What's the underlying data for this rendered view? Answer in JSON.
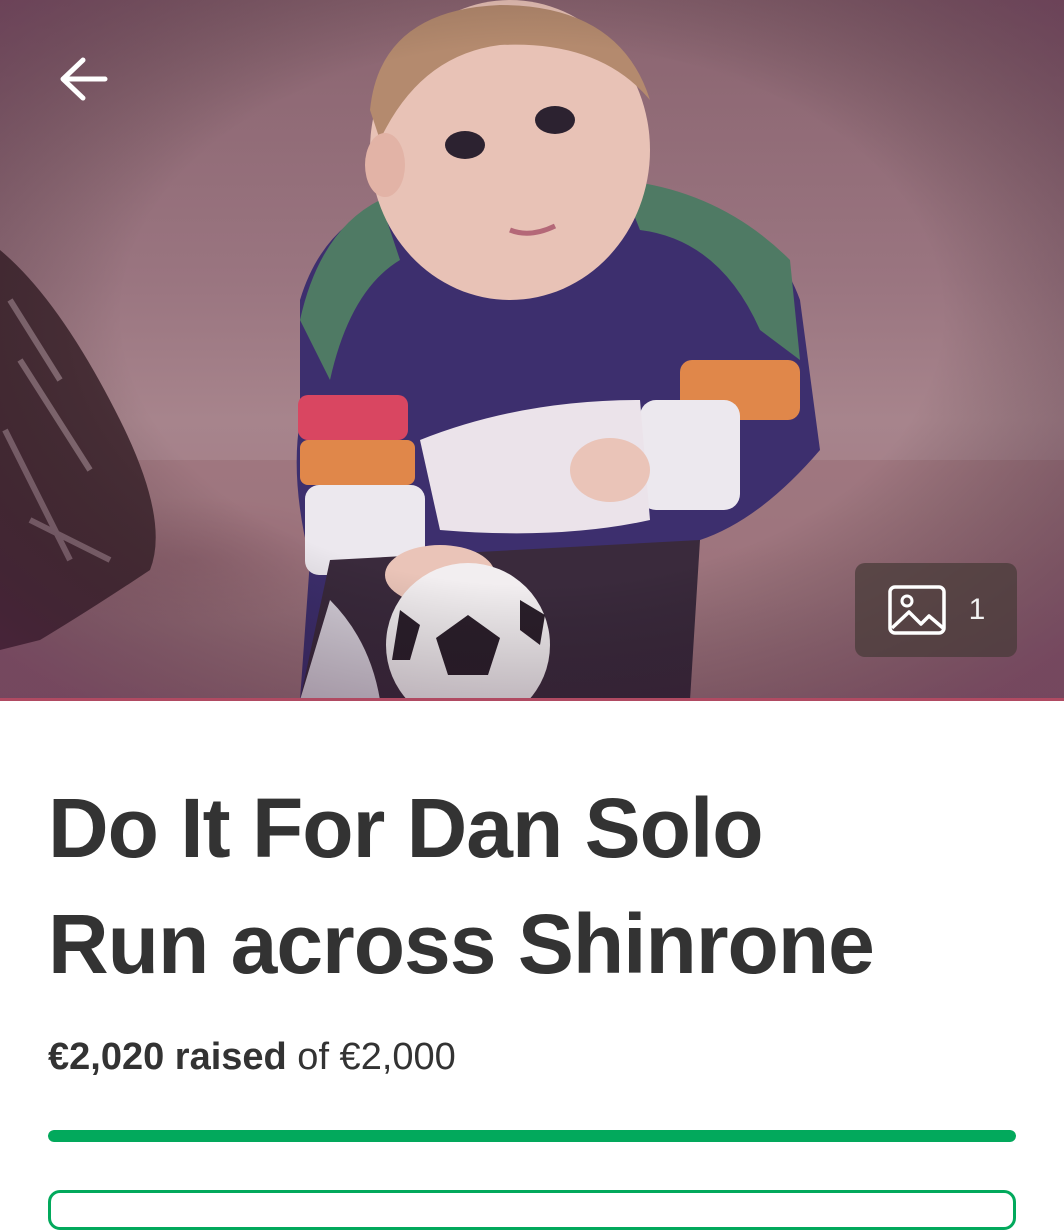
{
  "hero": {
    "photo_count": "1",
    "back_icon": "arrow-left-icon",
    "gallery_icon": "image-gallery-icon",
    "photo_alt": "Campaign photo"
  },
  "campaign": {
    "title_line1": "Do It For Dan Solo",
    "title_line2": "Run across Shinrone",
    "raised_amount": "€2,020 raised",
    "goal_text": " of €2,000",
    "progress_fraction": 1.0
  },
  "colors": {
    "accent": "#02a95c",
    "title_text": "#333333"
  }
}
